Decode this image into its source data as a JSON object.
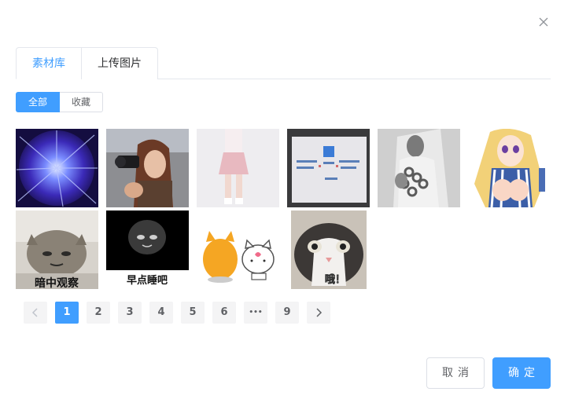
{
  "dialog": {
    "close_icon": "close-icon"
  },
  "tabs": [
    {
      "label": "素材库",
      "active": true
    },
    {
      "label": "上传图片",
      "active": false
    }
  ],
  "filter": {
    "all_label": "全部",
    "favorites_label": "收藏",
    "selected": "全部"
  },
  "images": [
    {
      "name": "image-purple-explosion"
    },
    {
      "name": "image-girl-with-camera"
    },
    {
      "name": "image-girl-pink-skirt"
    },
    {
      "name": "image-whiteboard"
    },
    {
      "name": "image-man-with-chains"
    },
    {
      "name": "image-anime-girl"
    },
    {
      "name": "image-cat-meme",
      "caption": "暗中观察"
    },
    {
      "name": "image-sleep-meme",
      "caption": "早点睡吧"
    },
    {
      "name": "image-cartoon-cats"
    },
    {
      "name": "image-cat-closeup",
      "caption": "哦！"
    }
  ],
  "pagination": {
    "pages": [
      "1",
      "2",
      "3",
      "4",
      "5",
      "6",
      "•••",
      "9"
    ],
    "current": "1",
    "prev_icon": "chevron-left-icon",
    "next_icon": "chevron-right-icon"
  },
  "footer": {
    "cancel_label": "取消",
    "confirm_label": "确定"
  },
  "colors": {
    "primary": "#409eff",
    "border": "#dcdfe6",
    "pager_bg": "#f4f4f5"
  }
}
